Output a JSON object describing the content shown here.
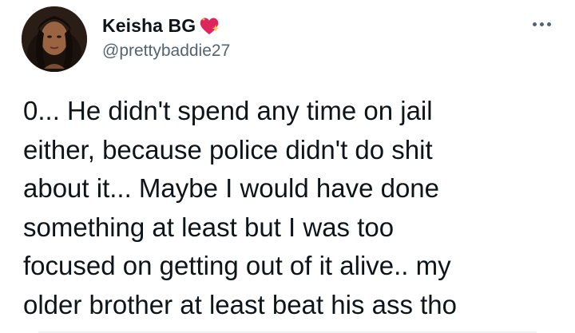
{
  "author": {
    "display_name": "Keisha BG",
    "name_emoji": "heart-with-sparkles",
    "handle": "@prettybaddie27"
  },
  "tweet": {
    "text": "0... He didn't spend any time on jail\neither, because police didn't do shit\nabout it... Maybe I would have done\nsomething at least but I was too\nfocused on getting out of it alive.. my\nolder brother at least beat his ass tho"
  },
  "icons": {
    "more": "more-horizontal-icon",
    "avatar": "profile-avatar"
  },
  "colors": {
    "text": "#0f1419",
    "secondary": "#536471",
    "heart": "#e0245e",
    "sparkle": "#ffcc4d"
  }
}
